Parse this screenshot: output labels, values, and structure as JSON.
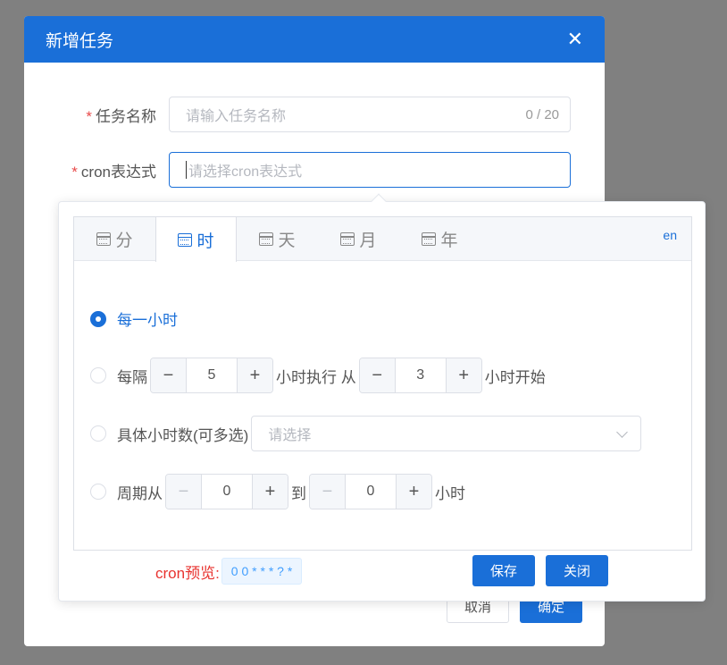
{
  "dialog": {
    "title": "新增任务",
    "close_glyph": "✕",
    "fields": [
      {
        "label": "任务名称",
        "placeholder": "请输入任务名称",
        "counter": "0 / 20"
      },
      {
        "label": "cron表达式",
        "placeholder": "请选择cron表达式"
      }
    ],
    "required_mark": "*",
    "cancel_label": "取消",
    "ok_label": "确定"
  },
  "cron": {
    "tabs": [
      "分",
      "时",
      "天",
      "月",
      "年"
    ],
    "active_tab": 1,
    "lang_toggle": "en",
    "options": {
      "every": "每一小时",
      "interval_prefix": "每隔",
      "interval_value": "5",
      "interval_middle": "小时执行 从",
      "interval_start": "3",
      "interval_suffix": "小时开始",
      "specific_label": "具体小时数(可多选)",
      "specific_placeholder": "请选择",
      "range_prefix": "周期从",
      "range_from": "0",
      "range_middle": "到",
      "range_to": "0",
      "range_suffix": "小时"
    },
    "selected_option": "every",
    "minus": "−",
    "plus": "+",
    "preview_label": "cron预览:",
    "preview_value": "0 0 * * * ? *",
    "save_label": "保存",
    "close_label": "关闭"
  },
  "colors": {
    "primary": "#1a6fd8",
    "overlay": "#808080",
    "preview_red": "#e8332f"
  }
}
